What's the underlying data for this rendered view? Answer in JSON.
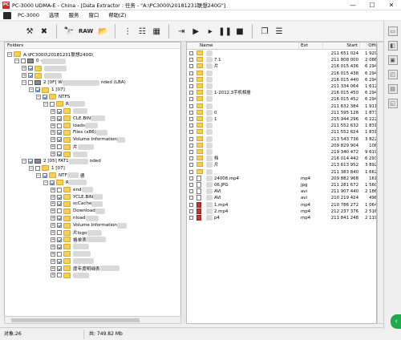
{
  "window": {
    "title": "PC-3000 UDMA-E - China - [Data Extractor : 任务 - \"A:\\PC3000\\20181231联想240G\"]",
    "app_icon_text": "PC",
    "controls": {
      "minimize": "—",
      "maximize": "☐",
      "close": "✕"
    }
  },
  "menu": [
    "PC-3000",
    "选项",
    "服务",
    "窗口",
    "帮助(Z)"
  ],
  "toolbar": {
    "raw_label": "RAW",
    "buttons": [
      "tools-icon",
      "close-icon",
      "binoculars-icon",
      "raw-button",
      "folder-open-icon",
      "tree-icon",
      "tree-expand-icon",
      "map-icon",
      "export-icon",
      "play-icon",
      "play-select-icon",
      "pause-icon",
      "stop-icon",
      "copy-icon",
      "tasks-icon"
    ]
  },
  "folders_panel": {
    "title": "Folders",
    "rows": [
      {
        "text": "A:\\PC3000\\20181231联想240G\\",
        "expand": "−"
      },
      {
        "text": "0 -",
        "expand": "−"
      },
      {
        "text": "",
        "expand": "+"
      },
      {
        "text": "",
        "expand": "+"
      },
      {
        "text": "2 [0F] W",
        "suffix": "nded  (LBA)",
        "expand": "−"
      },
      {
        "text": "1 [07]",
        "expand": "−"
      },
      {
        "text": "NTFS",
        "expand": "−"
      },
      {
        "text": "R",
        "expand": "−"
      },
      {
        "text": "",
        "expand": "+"
      },
      {
        "text": "CLE.BIN",
        "expand": "+"
      },
      {
        "text": "loads",
        "expand": "+"
      },
      {
        "text": "Files (x86)",
        "expand": "+"
      },
      {
        "text": "Volume Information",
        "expand": "+"
      },
      {
        "text": "片",
        "expand": "+"
      },
      {
        "text": "",
        "expand": "+"
      },
      {
        "text": "2 [05] FAT1",
        "suffix": "nded",
        "expand": "−"
      },
      {
        "text": "1 [07]",
        "expand": "−"
      },
      {
        "text": "NTF",
        "suffix": "德",
        "expand": "−"
      },
      {
        "text": "R",
        "expand": "−"
      },
      {
        "text": "end",
        "expand": "+"
      },
      {
        "text": "YCLE.BIN",
        "expand": "+"
      },
      {
        "text": "scCache",
        "expand": "+"
      },
      {
        "text": "Download",
        "expand": "+"
      },
      {
        "text": "nload",
        "expand": "+"
      },
      {
        "text": "Volume Information",
        "expand": "+"
      },
      {
        "text": "片logo",
        "expand": "+"
      },
      {
        "text": "格单表",
        "expand": "+"
      },
      {
        "text": "",
        "expand": "+"
      },
      {
        "text": "",
        "expand": "+"
      },
      {
        "text": "",
        "expand": "+"
      },
      {
        "text": "度年度明细表",
        "expand": "+"
      },
      {
        "text": "",
        "expand": "+"
      }
    ]
  },
  "files_panel": {
    "columns": [
      "Name",
      "Ext",
      "Start",
      "Offset"
    ],
    "rows": [
      {
        "name": "",
        "ext": "",
        "start": "211 651 024",
        "offset": "1 929 68",
        "icon": "folder"
      },
      {
        "name": "7.1",
        "ext": "",
        "start": "211 808 000",
        "offset": "2 086 65",
        "icon": "folder"
      },
      {
        "name": "片",
        "ext": "",
        "start": "216 015 436",
        "offset": "6 294 09",
        "icon": "folder"
      },
      {
        "name": "",
        "ext": "",
        "start": "216 015 438",
        "offset": "6 294 09",
        "icon": "folder"
      },
      {
        "name": "",
        "ext": "",
        "start": "216 015 440",
        "offset": "6 294 09",
        "icon": "folder"
      },
      {
        "name": "",
        "ext": "",
        "start": "211 334 064",
        "offset": "1 612 72",
        "icon": "folder"
      },
      {
        "name": "1-2012.3手机相册",
        "ext": "",
        "start": "216 015 450",
        "offset": "6 294 10",
        "icon": "folder"
      },
      {
        "name": "",
        "ext": "",
        "start": "216 015 452",
        "offset": "6 294 10",
        "icon": "folder"
      },
      {
        "name": "",
        "ext": "",
        "start": "211 632 384",
        "offset": "1 911 04",
        "icon": "folder"
      },
      {
        "name": "0",
        "ext": "",
        "start": "211 595 128",
        "offset": "1 873 78",
        "icon": "folder"
      },
      {
        "name": "1",
        "ext": "",
        "start": "215 944 296",
        "offset": "6 222 95",
        "icon": "folder"
      },
      {
        "name": "",
        "ext": "",
        "start": "211 552 632",
        "offset": "1 831 28",
        "icon": "folder"
      },
      {
        "name": "",
        "ext": "",
        "start": "211 552 624",
        "offset": "1 831 28",
        "icon": "folder"
      },
      {
        "name": "",
        "ext": "",
        "start": "213 543 736",
        "offset": "3 822 39",
        "icon": "folder"
      },
      {
        "name": "",
        "ext": "",
        "start": "209 829 904",
        "offset": "108 56",
        "icon": "folder"
      },
      {
        "name": "",
        "ext": "",
        "start": "219 340 472",
        "offset": "9 619 12",
        "icon": "folder"
      },
      {
        "name": "档",
        "ext": "",
        "start": "216 014 442",
        "offset": "6 293 09",
        "icon": "folder"
      },
      {
        "name": "片",
        "ext": "",
        "start": "213 613 952",
        "offset": "3 892 60",
        "icon": "folder"
      },
      {
        "name": "",
        "ext": "",
        "start": "211 383 840",
        "offset": "1 662 49",
        "icon": "folder"
      },
      {
        "name": "24008.mp4",
        "ext": "mp4",
        "start": "209 882 968",
        "offset": "161 62",
        "icon": "doc"
      },
      {
        "name": "06.JPG",
        "ext": "jpg",
        "start": "211 281 672",
        "offset": "1 560 32",
        "icon": "doc"
      },
      {
        "name": "AVI",
        "ext": "avi",
        "start": "211 907 440",
        "offset": "2 186 09",
        "icon": "doc"
      },
      {
        "name": "AVI",
        "ext": "avi",
        "start": "210 219 424",
        "offset": "498 08",
        "icon": "doc"
      },
      {
        "name": "1.mp4",
        "ext": "mp4",
        "start": "210 786 272",
        "offset": "1 064 92",
        "icon": "video"
      },
      {
        "name": "2.mp4",
        "ext": "mp4",
        "start": "212 237 376",
        "offset": "2 516 03",
        "icon": "video"
      },
      {
        "name": "p4",
        "ext": "mp4",
        "start": "211 841 248",
        "offset": "2 119 90",
        "icon": "video"
      }
    ]
  },
  "status": {
    "objects": "对象:26",
    "total": "共: 749.82 Mb"
  },
  "fab_icon": "arrow-left-icon"
}
